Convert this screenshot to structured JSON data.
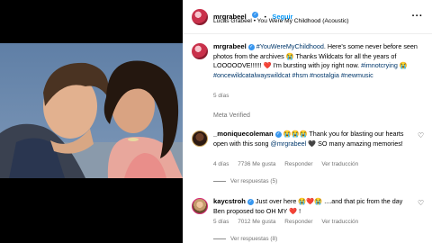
{
  "post": {
    "author": "mrgrabeel",
    "follow_label": "Seguir",
    "dot": "•",
    "audio": "Lucas Grabeel • You Were My Childhood (Acoustic)",
    "more_icon": "more-options-icon"
  },
  "caption": {
    "author": "mrgrabeel",
    "hashtag_main": "#YouWereMyChildhood",
    "text1": ". Here's some never before seen photos from the archives 😭 Thanks Wildcats for all the years of LOOOOOVE!!!!!! ❤️ I'm bursting with joy right now.",
    "hashtags": "#imnotcrying 😭 #oncewildcatalwayswildcat #hsm #nostalgia #newmusic",
    "age": "5 días"
  },
  "meta_verified": "Meta Verified",
  "comments": [
    {
      "author": "_moniquecoleman",
      "text_before": " 😭😭😭 Thank you for blasting our hearts open with this song ",
      "mention": "@mrgrabeel",
      "text_after": " 🖤 SO many amazing memories!",
      "age": "4 días",
      "likes": "7736 Me gusta",
      "reply": "Responder",
      "translate": "Ver traducción",
      "replies": "Ver respuestas (5)"
    },
    {
      "author": "kaycstroh",
      "text": " Just over here 😭❤️😭 ....and that pic from the day Ben proposed too OH MY ❤️ !",
      "age": "5 días",
      "likes": "7012 Me gusta",
      "reply": "Responder",
      "translate": "Ver traducción",
      "replies": "Ver respuestas (8)"
    }
  ],
  "icons": {
    "verified": "✓",
    "heart": "♡",
    "more": "···"
  }
}
